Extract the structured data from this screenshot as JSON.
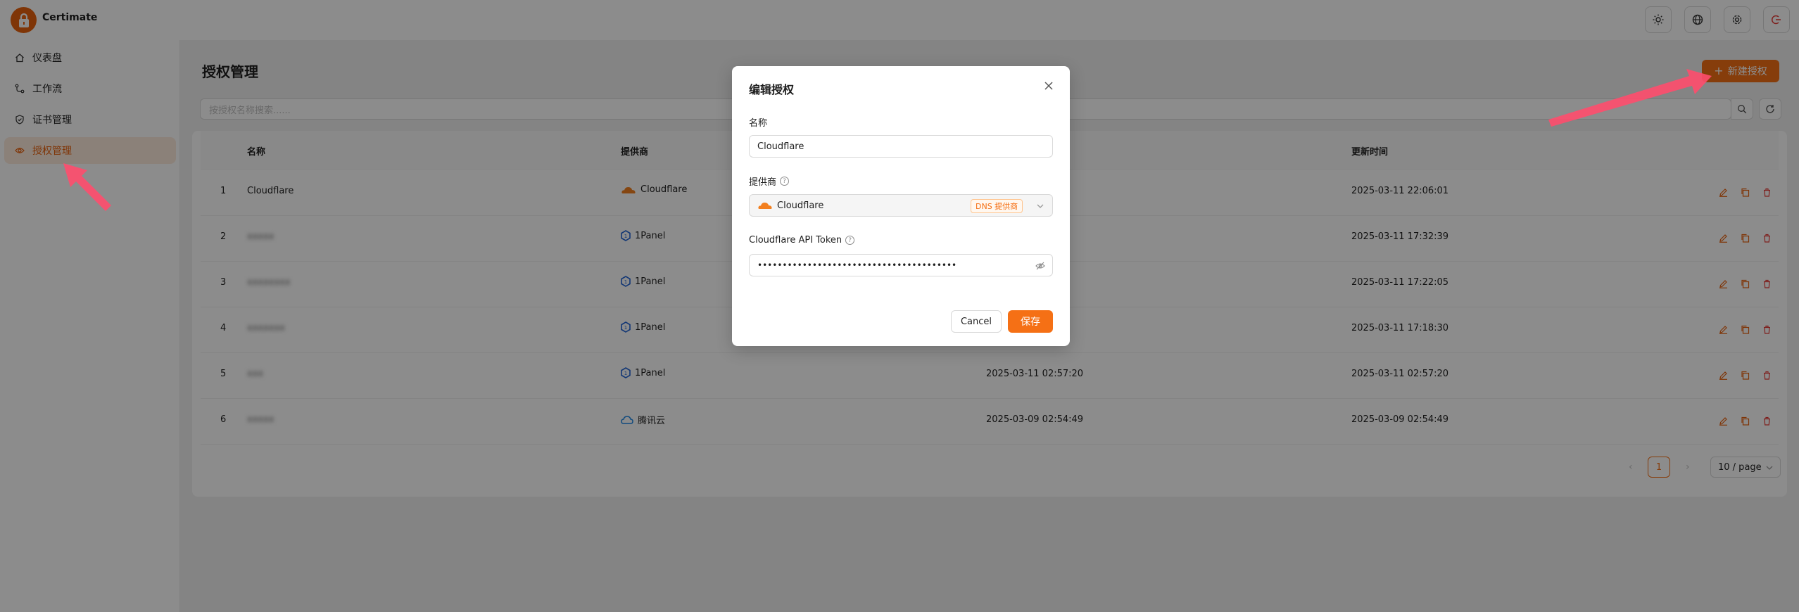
{
  "app": {
    "name": "Certimate"
  },
  "sidebar": {
    "items": [
      {
        "label": "仪表盘",
        "icon": "home-icon"
      },
      {
        "label": "工作流",
        "icon": "workflow-icon"
      },
      {
        "label": "证书管理",
        "icon": "shield-check-icon"
      },
      {
        "label": "授权管理",
        "icon": "eye-icon",
        "active": true
      }
    ]
  },
  "page": {
    "title": "授权管理",
    "new_button": "新建授权",
    "search_placeholder": "按授权名称搜索......"
  },
  "table": {
    "columns": [
      "名称",
      "提供商",
      "更新时间"
    ],
    "rows": [
      {
        "index": "1",
        "name": "Cloudflare",
        "provider": "Cloudflare",
        "created": "",
        "updated": "2025-03-11 22:06:01",
        "blurred": false
      },
      {
        "index": "2",
        "name": "xxxxx",
        "provider": "1Panel",
        "created": "",
        "updated": "2025-03-11 17:32:39",
        "blurred": true
      },
      {
        "index": "3",
        "name": "xxxxxxxx",
        "provider": "1Panel",
        "created": "",
        "updated": "2025-03-11 17:22:05",
        "blurred": true
      },
      {
        "index": "4",
        "name": "xxxxxxx",
        "provider": "1Panel",
        "created": "",
        "updated": "2025-03-11 17:18:30",
        "blurred": true
      },
      {
        "index": "5",
        "name": "xxx",
        "provider": "1Panel",
        "created": "2025-03-11 02:57:20",
        "updated": "2025-03-11 02:57:20",
        "blurred": true
      },
      {
        "index": "6",
        "name": "xxxxx",
        "provider": "腾讯云",
        "created": "2025-03-09 02:54:49",
        "updated": "2025-03-09 02:54:49",
        "blurred": true
      }
    ]
  },
  "pagination": {
    "current": "1",
    "page_size": "10 / page"
  },
  "modal": {
    "title": "编辑授权",
    "name_label": "名称",
    "name_value": "Cloudflare",
    "provider_label": "提供商",
    "provider_value": "Cloudflare",
    "provider_tag": "DNS 提供商",
    "token_label": "Cloudflare API Token",
    "token_value": "••••••••••••••••••••••••••••••••••••••••",
    "cancel": "Cancel",
    "save": "保存"
  },
  "colors": {
    "accent": "#f57015",
    "overlay": "rgba(0,0,0,0.45)",
    "arrow": "#ff4d6d"
  }
}
